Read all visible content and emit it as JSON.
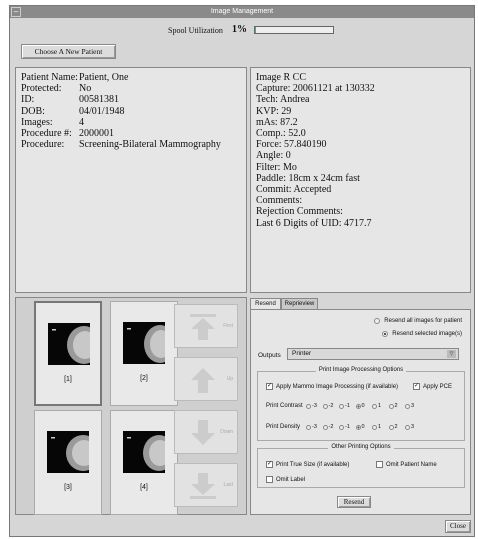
{
  "window": {
    "title": "Image Management"
  },
  "spool": {
    "label": "Spool Utilization",
    "value": "1%",
    "fraction": 0.01
  },
  "buttons": {
    "choose_patient": "Choose A New Patient",
    "resend": "Resend",
    "close": "Close"
  },
  "patient": [
    {
      "k": "Patient Name:",
      "v": "Patient, One"
    },
    {
      "k": "Protected:",
      "v": "No"
    },
    {
      "k": "ID:",
      "v": "00581381"
    },
    {
      "k": "DOB:",
      "v": "04/01/1948"
    },
    {
      "k": "Images:",
      "v": "4"
    },
    {
      "k": "Procedure #:",
      "v": "2000001"
    },
    {
      "k": "Procedure:",
      "v": "Screening-Bilateral Mammography"
    }
  ],
  "image_info": [
    "Image R CC",
    "Capture: 20061121 at 130332",
    "Tech: Andrea",
    "KVP: 29",
    "mAs: 87.2",
    "Comp.: 52.0",
    "Force: 57.840190",
    "Angle: 0",
    "Filter: Mo",
    "Paddle: 18cm x 24cm fast",
    "Commit: Accepted",
    "Comments:",
    "Rejection Comments:",
    "Last 6 Digits of UID: 4717.7"
  ],
  "thumbnails": [
    "[1]",
    "[2]",
    "[3]",
    "[4]"
  ],
  "arrows": {
    "first": "First",
    "up": "Up",
    "down": "Down",
    "last": "Last"
  },
  "tabs": [
    "Resend",
    "Reprieview"
  ],
  "resend": {
    "all_images": "Resend all images for patient",
    "selected_images": "Resend selected image(s)",
    "outputs_label": "Outputs",
    "outputs_value": "Printer"
  },
  "print_processing": {
    "title": "Print Image Processing Options",
    "apply_mammo": "Apply Mammo Image Processing (if available)",
    "apply_pce": "Apply PCE",
    "contrast_label": "Print Contrast",
    "density_label": "Print Density",
    "scale": [
      "-3",
      "-2",
      "-1",
      "0",
      "1",
      "2",
      "3"
    ],
    "selected": "0"
  },
  "other_options": {
    "title": "Other Printing Options",
    "true_size": "Print True Size (if available)",
    "omit_patient": "Omit Patient Name",
    "omit_label": "Omit Label"
  },
  "colors": {
    "window_bg": "#d6d6d6",
    "panel_bg": "#e6e6e6",
    "titlebar": "#8a8a8a"
  },
  "icons": [
    "arrow-up-icon",
    "arrow-down-icon",
    "dropdown-arrow-icon",
    "mammogram-thumbnail"
  ]
}
